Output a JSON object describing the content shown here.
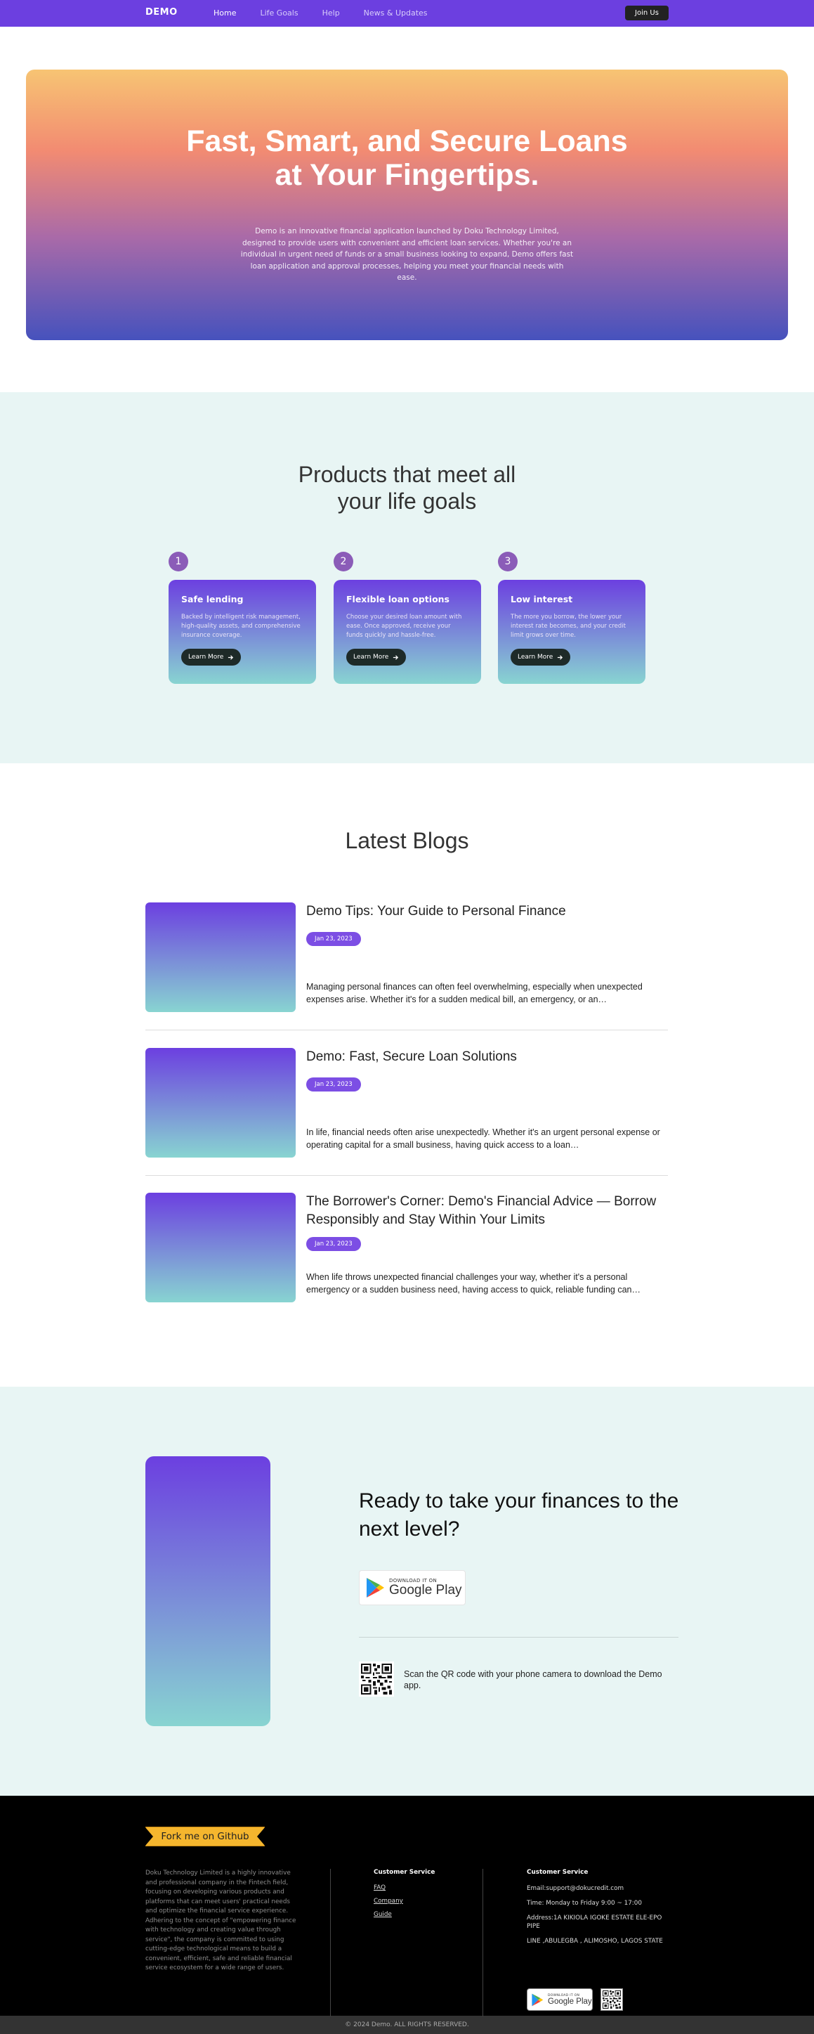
{
  "nav": {
    "logo": "DEMO",
    "links": [
      "Home",
      "Life Goals",
      "Help",
      "News & Updates"
    ],
    "join": "Join Us"
  },
  "hero": {
    "title_line1": "Fast, Smart, and Secure Loans",
    "title_line2": "at Your Fingertips.",
    "description": "Demo is an innovative financial application launched by Doku Technology Limited, designed to provide users with convenient and efficient loan services. Whether you're an individual in urgent need of funds or a small business looking to expand, Demo offers fast loan application and approval processes, helping you meet your financial needs with ease."
  },
  "products": {
    "title_line1": "Products that meet all",
    "title_line2": "your life goals",
    "items": [
      {
        "num": "1",
        "title": "Safe lending",
        "desc": "Backed by intelligent risk management, high-quality assets, and comprehensive insurance coverage.",
        "button": "Learn More"
      },
      {
        "num": "2",
        "title": "Flexible loan options",
        "desc": "Choose your desired loan amount with ease. Once approved, receive your funds quickly and hassle-free.",
        "button": "Learn More"
      },
      {
        "num": "3",
        "title": "Low interest",
        "desc": "The more you borrow, the lower your interest rate becomes, and your credit limit grows over time.",
        "button": "Learn More"
      }
    ]
  },
  "blogs": {
    "title": "Latest Blogs",
    "items": [
      {
        "title": "Demo Tips: Your Guide to Personal Finance",
        "date": "Jan 23, 2023",
        "excerpt": "Managing personal finances can often feel overwhelming, especially when unexpected expenses arise. Whether it's for a sudden medical bill, an emergency, or an…"
      },
      {
        "title": "Demo: Fast, Secure Loan Solutions",
        "date": "Jan 23, 2023",
        "excerpt": "In life, financial needs often arise unexpectedly. Whether it's an urgent personal expense or operating capital for a small business, having quick access to a loan…"
      },
      {
        "title": "The Borrower's Corner: Demo's Financial Advice — Borrow Responsibly and Stay Within Your Limits",
        "date": "Jan 23, 2023",
        "excerpt": "When life throws unexpected financial challenges your way, whether it's a personal emergency or a sudden business need, having access to quick, reliable funding can…"
      }
    ]
  },
  "cta": {
    "title": "Ready to take your finances to the next level?",
    "store_small": "DOWNLOAD IT ON",
    "store_name": "Google Play",
    "scan_text": "Scan the QR code with your phone camera to download the Demo app."
  },
  "footer": {
    "ribbon": "Fork me on Github",
    "about": "Doku Technology Limited is a highly innovative and professional company in the Fintech field, focusing on developing various products and platforms that can meet users' practical needs and optimize the financial service experience. Adhering to the concept of \"empowering finance with technology and creating value through service\", the company is committed to using cutting-edge technological means to build a convenient, efficient, safe and reliable financial service ecosystem for a wide range of users.",
    "col1_heading": "Customer Service",
    "col1_links": [
      "FAQ",
      "Company",
      "Guide"
    ],
    "col2_heading": "Customer Service",
    "email": "Email:support@dokucredit.com",
    "time": "Time: Monday to Friday 9:00 ~ 17:00",
    "address1": "Address:1A KIKIOLA IGOKE ESTATE ELE-EPO PIPE",
    "address2": "LINE ,ABULEGBA , ALIMOSHO, LAGOS STATE",
    "store_small": "DOWNLOAD IT ON",
    "store_name": "Google Play",
    "copyright": "© 2024 Demo. ALL RIGHTS RESERVED."
  },
  "colors": {
    "primary": "#6c3fe0",
    "teal": "#88d4d1",
    "mint_bg": "#e8f5f4",
    "ribbon": "#f5b62e"
  },
  "icons": [
    "arrow-right-icon",
    "google-play-icon",
    "qr-code-icon"
  ]
}
